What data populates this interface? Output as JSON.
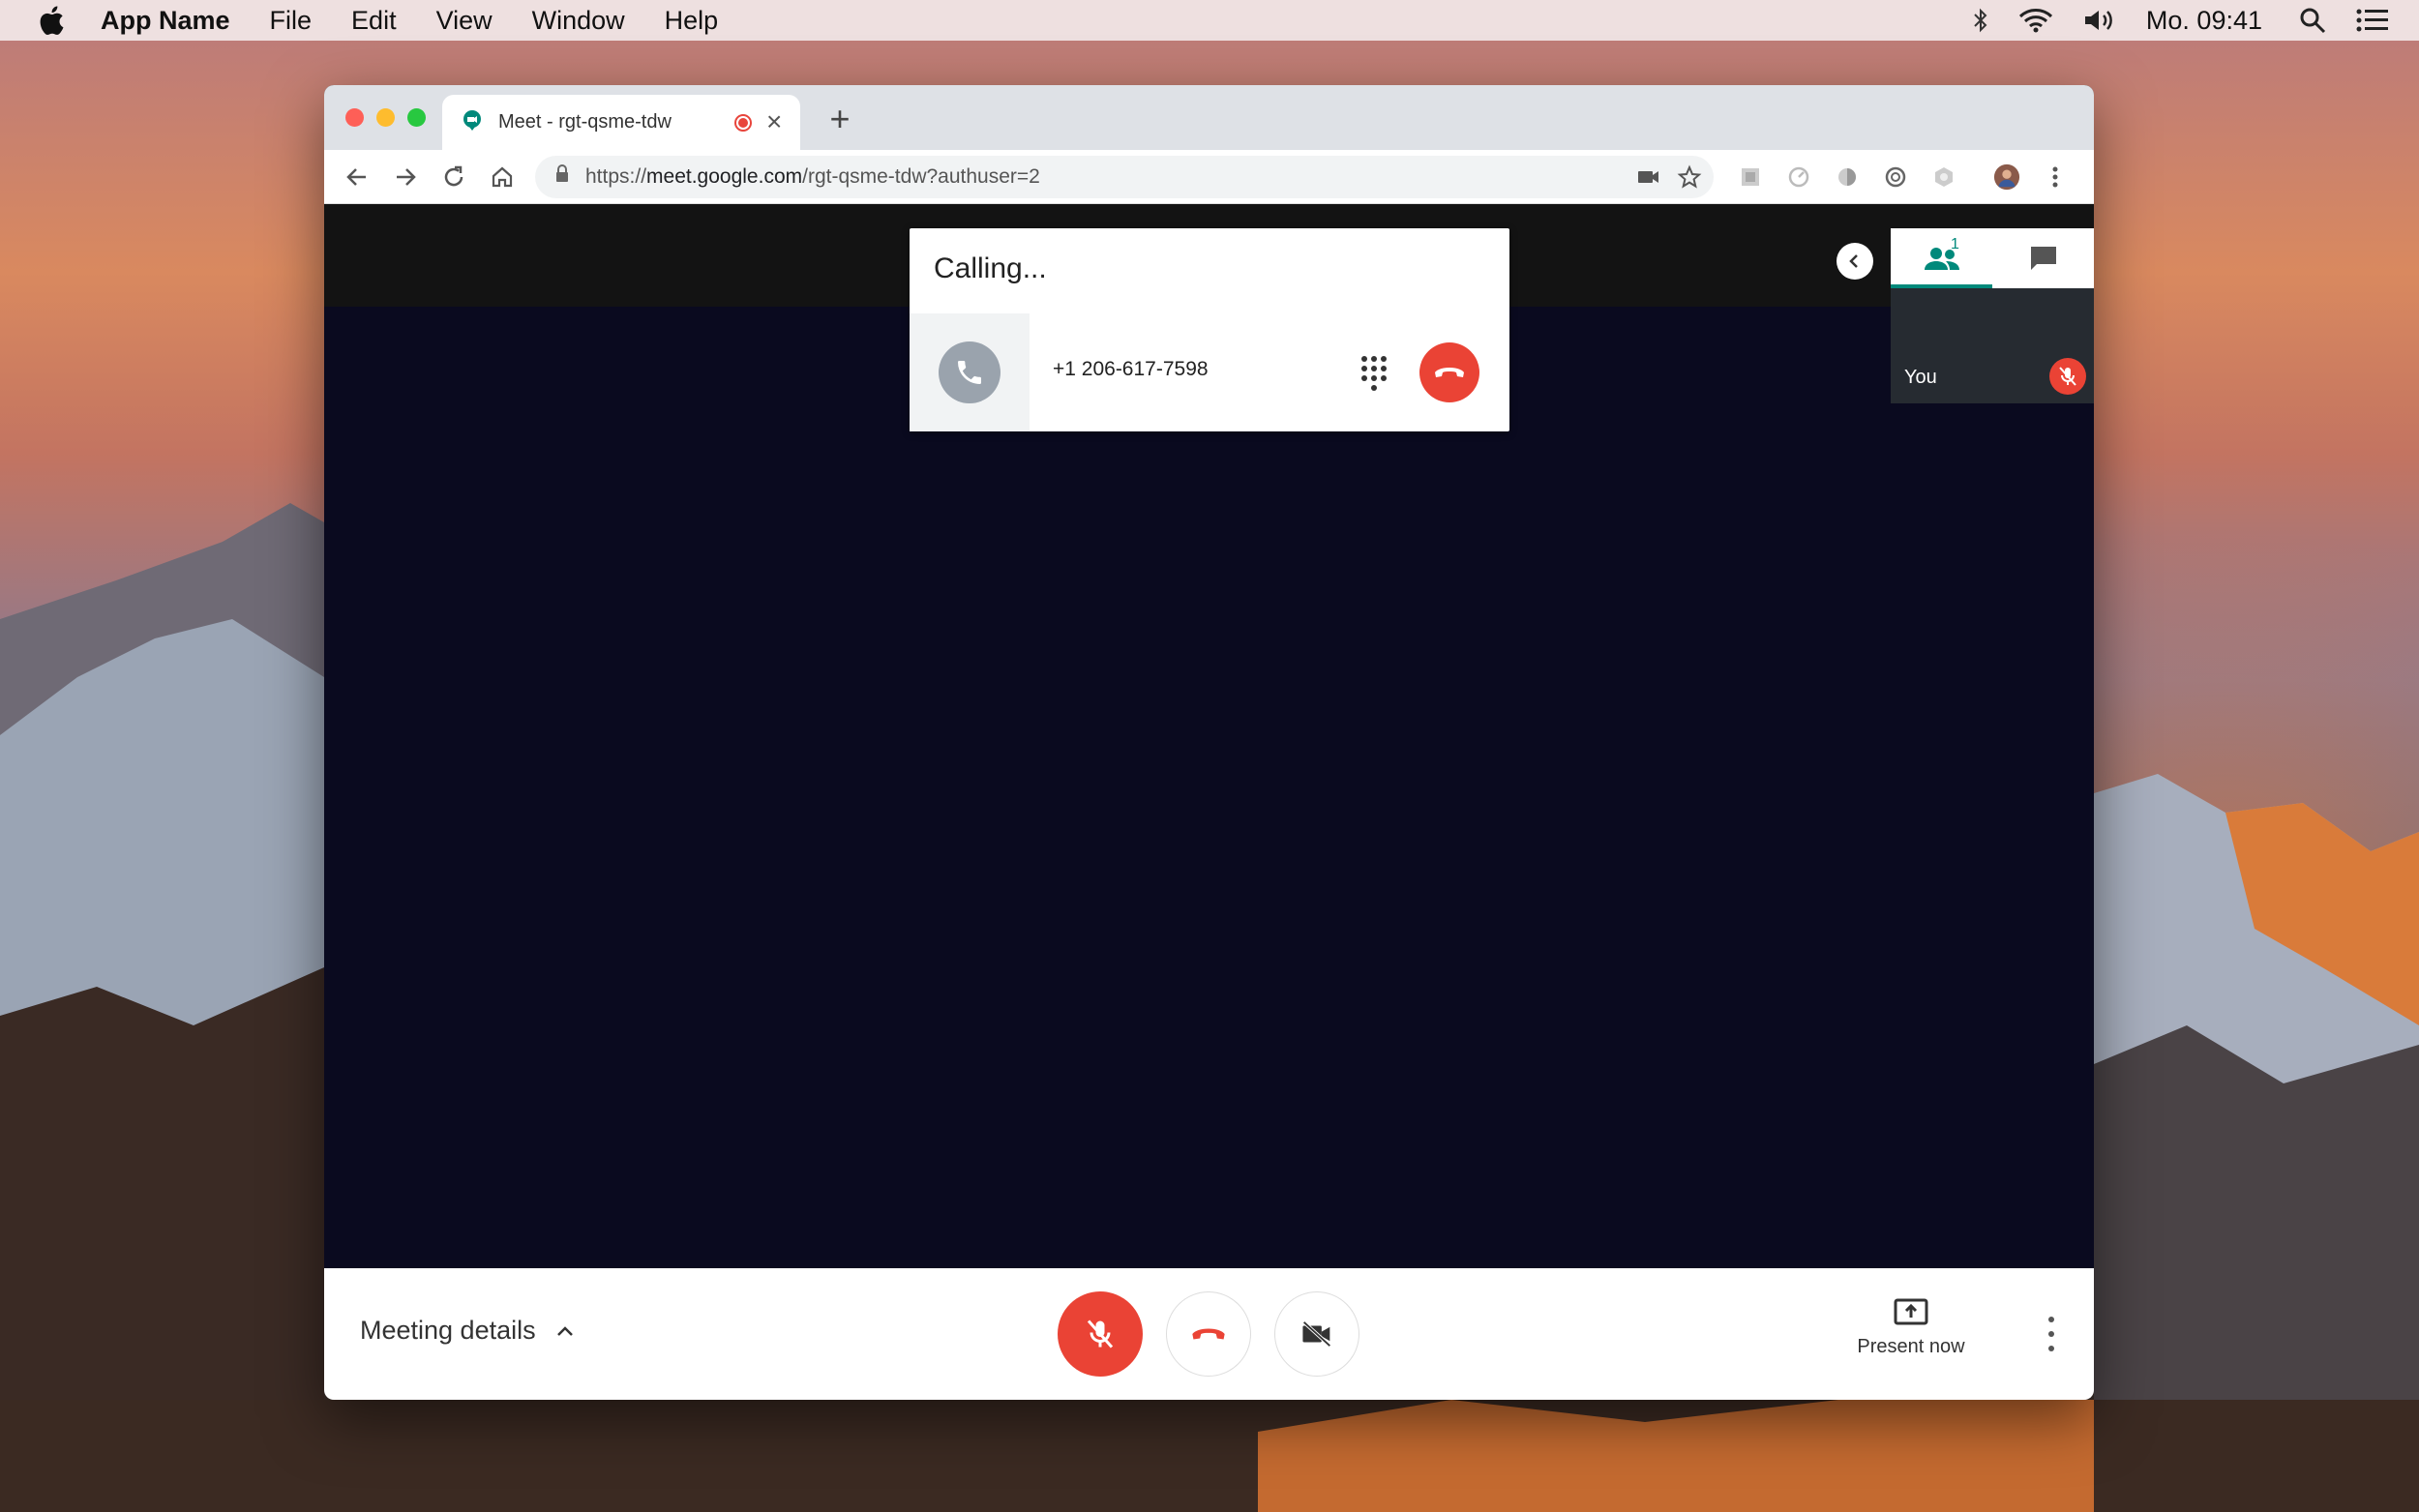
{
  "menubar": {
    "app_name": "App Name",
    "items": [
      "File",
      "Edit",
      "View",
      "Window",
      "Help"
    ],
    "clock": "Mo. 09:41"
  },
  "browser": {
    "tab_title": "Meet - rgt-qsme-tdw",
    "url_prefix": "https://",
    "url_host": "meet.google.com",
    "url_path": "/rgt-qsme-tdw?authuser=2"
  },
  "calling": {
    "title": "Calling...",
    "number": "+1 206-617-7598"
  },
  "participants": {
    "count": "1",
    "self_label": "You"
  },
  "controls": {
    "meeting_details": "Meeting details",
    "present_now": "Present now"
  },
  "colors": {
    "red": "#ea4335",
    "teal": "#00897b"
  }
}
